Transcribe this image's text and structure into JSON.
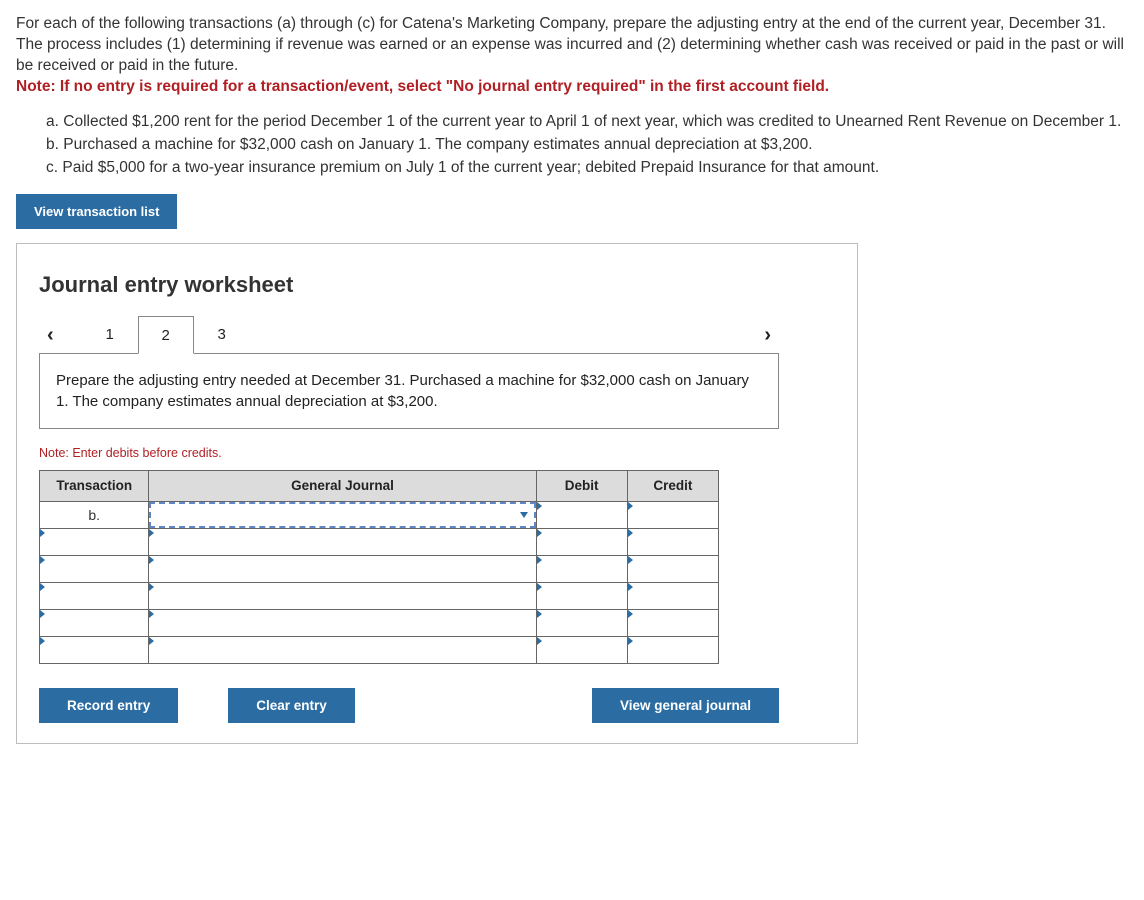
{
  "problem": {
    "intro": "For each of the following transactions (a) through (c) for Catena's Marketing Company, prepare the adjusting entry at the end of the current year, December 31. The process includes (1) determining if revenue was earned or an expense was incurred and (2) determining whether cash was received or paid in the past or will be received or paid in the future.",
    "note": "Note: If no entry is required for a transaction/event, select \"No journal entry required\" in the first account field.",
    "items": [
      {
        "label": "a.",
        "text": "Collected $1,200 rent for the period December 1 of the current year to April 1 of next year, which was credited to Unearned Rent Revenue on December 1."
      },
      {
        "label": "b.",
        "text": "Purchased a machine for $32,000 cash on January 1. The company estimates annual depreciation at $3,200."
      },
      {
        "label": "c.",
        "text": "Paid $5,000 for a two-year insurance premium on July 1 of the current year; debited Prepaid Insurance for that amount."
      }
    ]
  },
  "buttons": {
    "view_list": "View transaction list",
    "record": "Record entry",
    "clear": "Clear entry",
    "view_journal": "View general journal"
  },
  "worksheet": {
    "title": "Journal entry worksheet",
    "tabs": [
      "1",
      "2",
      "3"
    ],
    "active_tab": "2",
    "prompt": "Prepare the adjusting entry needed at December 31. Purchased a machine for $32,000 cash on January 1. The company estimates annual depreciation at $3,200.",
    "note": "Note: Enter debits before credits.",
    "headers": {
      "txn": "Transaction",
      "gj": "General Journal",
      "debit": "Debit",
      "credit": "Credit"
    },
    "rows": [
      {
        "txn": "b.",
        "gj": "",
        "debit": "",
        "credit": "",
        "gj_active": true
      },
      {
        "txn": "",
        "gj": "",
        "debit": "",
        "credit": "",
        "gj_active": false
      },
      {
        "txn": "",
        "gj": "",
        "debit": "",
        "credit": "",
        "gj_active": false
      },
      {
        "txn": "",
        "gj": "",
        "debit": "",
        "credit": "",
        "gj_active": false
      },
      {
        "txn": "",
        "gj": "",
        "debit": "",
        "credit": "",
        "gj_active": false
      },
      {
        "txn": "",
        "gj": "",
        "debit": "",
        "credit": "",
        "gj_active": false
      }
    ]
  }
}
